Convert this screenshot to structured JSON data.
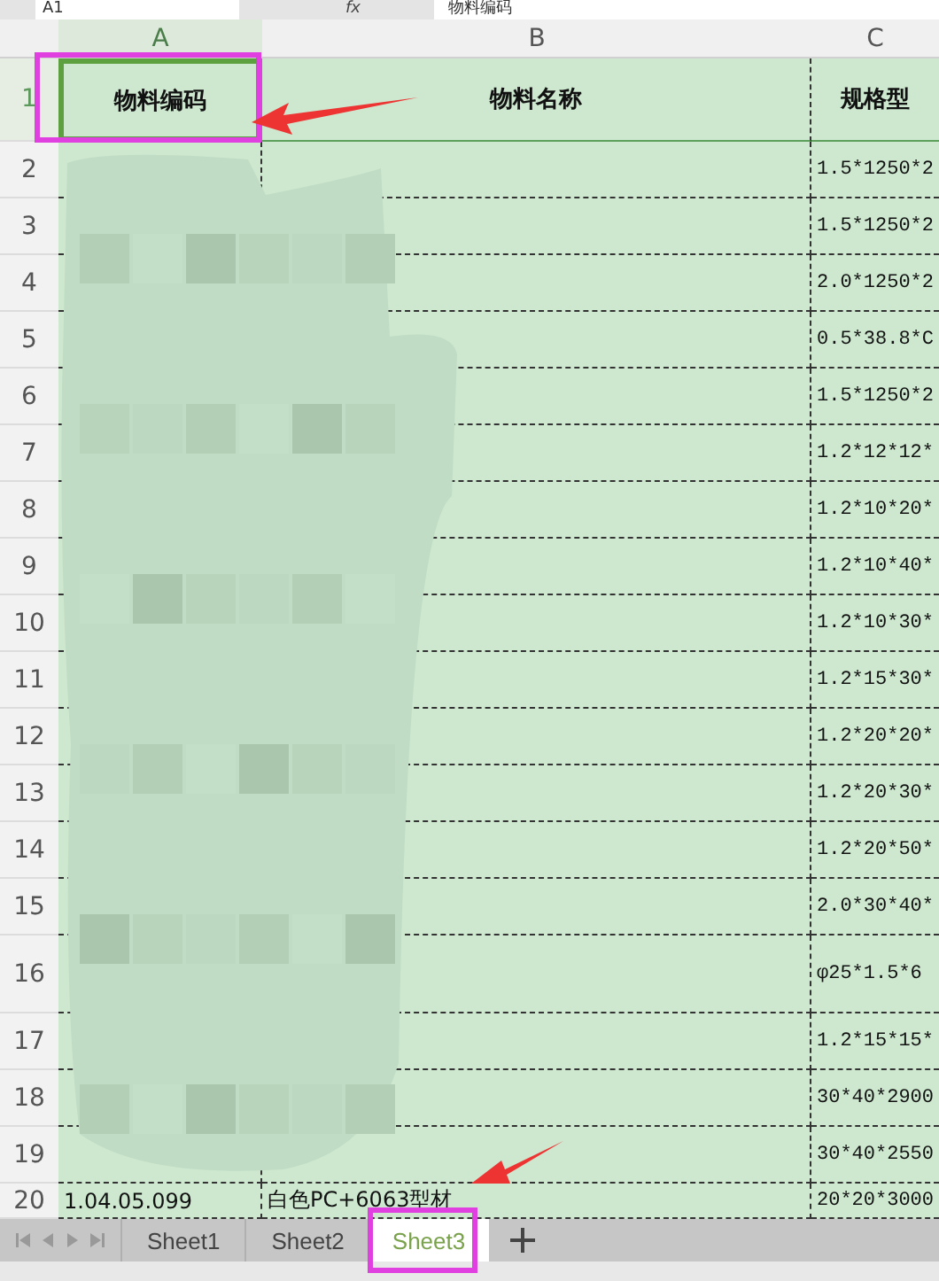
{
  "formula_bar": {
    "name_box": "A1",
    "function_symbol": "fx",
    "content": "物料编码"
  },
  "columns": [
    {
      "label": "A",
      "selected": true
    },
    {
      "label": "B",
      "selected": false
    },
    {
      "label": "C",
      "selected": false
    }
  ],
  "header_row": {
    "number": "1",
    "selected": true,
    "cells": [
      {
        "text": "物料编码",
        "selected": true
      },
      {
        "text": "物料名称",
        "selected": false
      },
      {
        "text": "规格型",
        "selected": false
      }
    ]
  },
  "rows": [
    {
      "number": "2",
      "spec": "1.5*1250*2"
    },
    {
      "number": "3",
      "spec": "1.5*1250*2"
    },
    {
      "number": "4",
      "spec": "2.0*1250*2"
    },
    {
      "number": "5",
      "spec": "0.5*38.8*C"
    },
    {
      "number": "6",
      "spec": "1.5*1250*2"
    },
    {
      "number": "7",
      "spec": "1.2*12*12*"
    },
    {
      "number": "8",
      "spec": "1.2*10*20*"
    },
    {
      "number": "9",
      "spec": "1.2*10*40*"
    },
    {
      "number": "10",
      "spec": "1.2*10*30*"
    },
    {
      "number": "11",
      "spec": "1.2*15*30*"
    },
    {
      "number": "12",
      "spec": "1.2*20*20*"
    },
    {
      "number": "13",
      "spec": "1.2*20*30*"
    },
    {
      "number": "14",
      "spec": "1.2*20*50*"
    },
    {
      "number": "15",
      "spec": "2.0*30*40*"
    },
    {
      "number": "16",
      "spec": "φ25*1.5*6"
    },
    {
      "number": "17",
      "spec": "1.2*15*15*"
    },
    {
      "number": "18",
      "spec": "30*40*2900"
    },
    {
      "number": "19",
      "spec": "30*40*2550"
    },
    {
      "number": "20",
      "code": "1.04.05.099",
      "name": "白色PC+6063型材",
      "spec": "20*20*3000"
    }
  ],
  "sheet_tabs": [
    {
      "label": "Sheet1",
      "selected": false
    },
    {
      "label": "Sheet2",
      "selected": false
    },
    {
      "label": "Sheet3",
      "selected": true
    }
  ]
}
